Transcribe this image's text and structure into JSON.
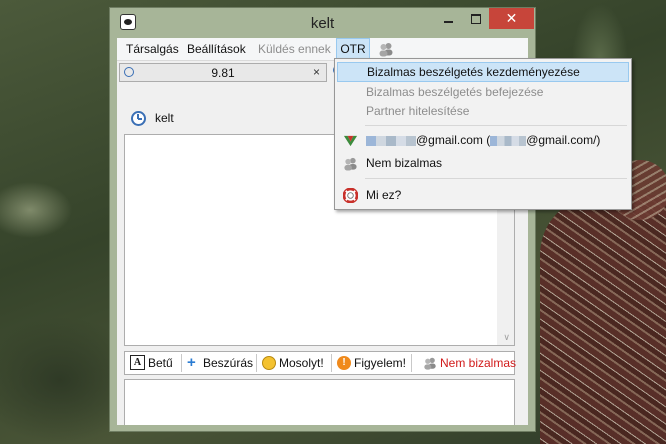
{
  "window": {
    "title": "kelt",
    "close_glyph": "✕"
  },
  "menubar": {
    "items": [
      {
        "label": "Társalgás"
      },
      {
        "label": "Beállítások"
      },
      {
        "label": "Küldés ennek"
      },
      {
        "label": "OTR"
      }
    ]
  },
  "tab": {
    "label": "9.81",
    "close_glyph": "×"
  },
  "contact": {
    "name": "kelt"
  },
  "toolbar": {
    "font_label": "Betű",
    "insert_label": "Beszúrás",
    "smile_label": "Mosolyt!",
    "attention_label": "Figyelem!",
    "otr_status_label": "Nem bizalmas"
  },
  "otr_menu": {
    "start": "Bizalmas beszélgetés kezdeményezése",
    "end": "Bizalmas beszélgetés befejezése",
    "auth": "Partner hitelesítése",
    "account_suffix": "@gmail.com (",
    "account_suffix2": "@gmail.com/)",
    "status": "Nem bizalmas",
    "help": "Mi ez?"
  },
  "colors": {
    "highlight": "#cce4f7",
    "close_button": "#c7453a",
    "not_private": "#d11a1a"
  }
}
